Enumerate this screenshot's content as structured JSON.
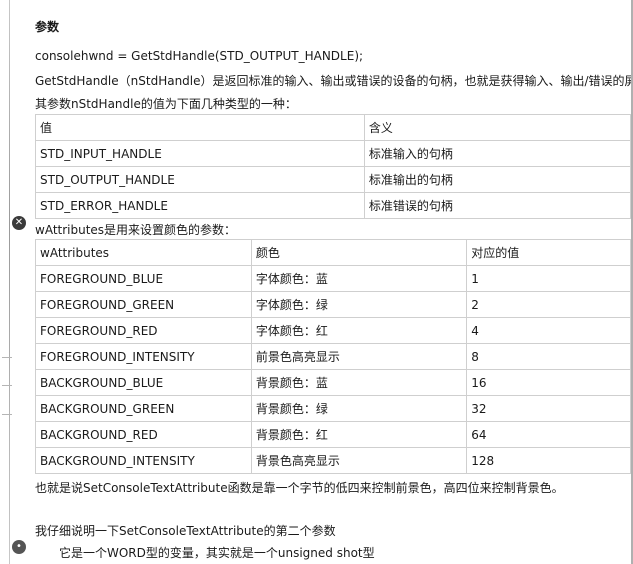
{
  "heading": "参数",
  "code_line": "consolehwnd = GetStdHandle(STD_OUTPUT_HANDLE);",
  "desc_line": "GetStdHandle（nStdHandle）是返回标准的输入、输出或错误的设备的句柄，也就是获得输入、输出/错误的屏",
  "param_intro": "其参数nStdHandle的值为下面几种类型的一种：",
  "handle_table": {
    "headers": [
      "值",
      "含义"
    ],
    "rows": [
      [
        "STD_INPUT_HANDLE",
        "标准输入的句柄"
      ],
      [
        "STD_OUTPUT_HANDLE",
        "标准输出的句柄"
      ],
      [
        "STD_ERROR_HANDLE",
        "标准错误的句柄"
      ]
    ]
  },
  "attr_intro": "wAttributes是用来设置颜色的参数：",
  "attr_table": {
    "headers": [
      "wAttributes",
      "颜色",
      "对应的值"
    ],
    "rows": [
      [
        "FOREGROUND_BLUE",
        "字体颜色：蓝",
        "1"
      ],
      [
        "FOREGROUND_GREEN",
        "字体颜色：绿",
        "2"
      ],
      [
        "FOREGROUND_RED",
        "字体颜色：红",
        "4"
      ],
      [
        "FOREGROUND_INTENSITY",
        "前景色高亮显示",
        "8"
      ],
      [
        "BACKGROUND_BLUE",
        "背景颜色：蓝",
        "16"
      ],
      [
        "BACKGROUND_GREEN",
        "背景颜色：绿",
        "32"
      ],
      [
        "BACKGROUND_RED",
        "背景颜色：红",
        "64"
      ],
      [
        "BACKGROUND_INTENSITY",
        "背景色高亮显示",
        "128"
      ]
    ]
  },
  "summary_line": "也就是说SetConsoleTextAttribute函数是靠一个字节的低四来控制前景色，高四位来控制背景色。",
  "explain_line": "我仔细说明一下SetConsoleTextAttribute的第二个参数",
  "word_line": "它是一个WORD型的变量，其实就是一个unsigned shot型"
}
